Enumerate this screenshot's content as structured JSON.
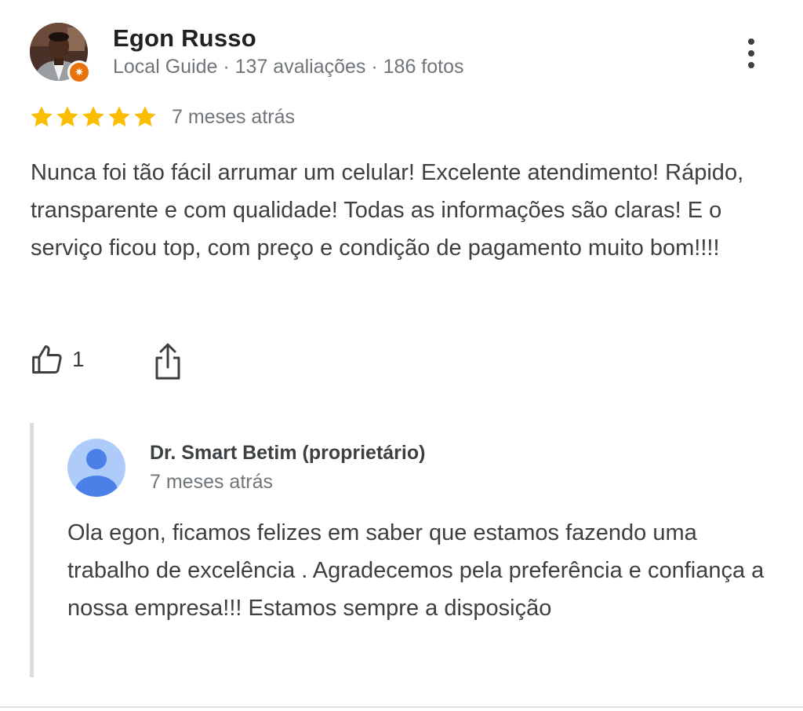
{
  "review": {
    "reviewer": {
      "name": "Egon Russo",
      "meta": "Local Guide · 137 avaliações · 186 fotos",
      "badge_icon": "local-guide-star-icon"
    },
    "rating": 5,
    "rating_max": 5,
    "star_color": "#fbbc04",
    "date": "7 meses atrás",
    "text": "Nunca foi tão fácil arrumar um celular! Excelente atendimento! Rápido, transparente e com qualidade! Todas as informações são claras! E o serviço ficou top, com preço e condição de pagamento muito bom!!!!",
    "actions": {
      "like_icon": "thumbs-up-icon",
      "like_count": "1",
      "share_icon": "share-icon",
      "more_icon": "more-vert-icon"
    }
  },
  "owner_reply": {
    "name": "Dr. Smart Betim (proprietário)",
    "date": "7 meses atrás",
    "text": "Ola egon, ficamos felizes em saber que estamos fazendo uma trabalho de excelência . Agradecemos pela preferência e confiança a nossa empresa!!! Estamos sempre a disposição",
    "avatar_color": "#aecbfa",
    "avatar_figure_color": "#4a80e8"
  }
}
